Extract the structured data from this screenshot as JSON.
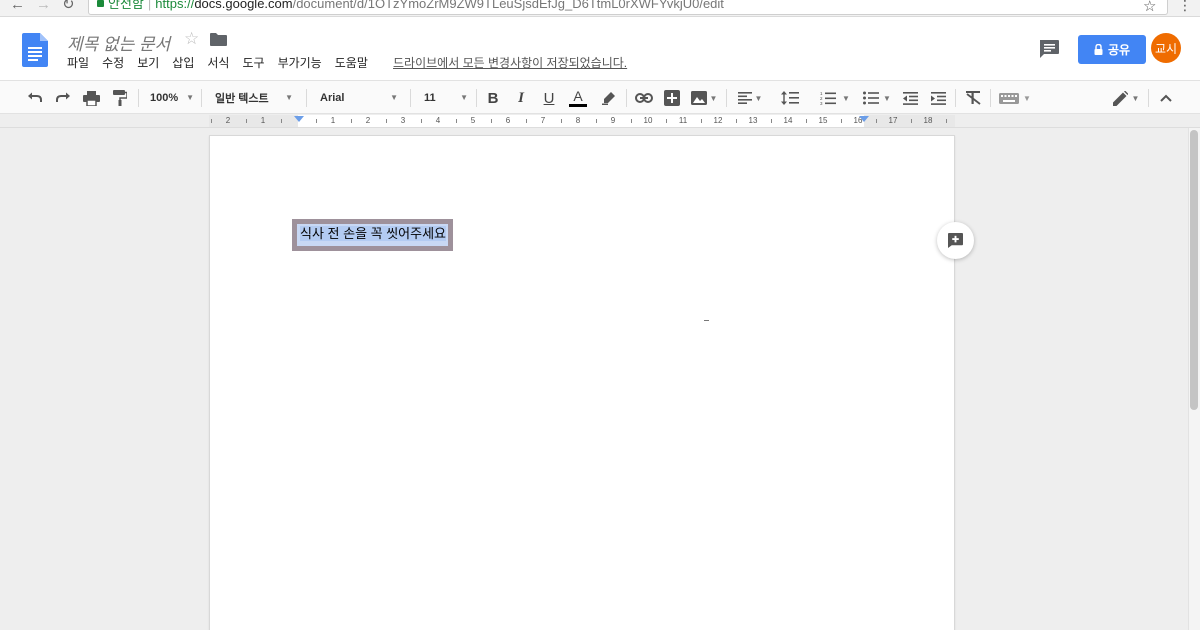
{
  "browser": {
    "back_glyph": "←",
    "forward_glyph": "→",
    "reload_glyph": "↻",
    "secure_label": "안전함",
    "url_scheme": "https://",
    "url_host": "docs.google.com",
    "url_path": "/document/d/1OTzYmoZrM9ZW9TLeuSjsdEfJg_D6TtmL0rXWFYvkjU0/edit",
    "star_glyph": "☆",
    "menu_glyph": "⋮"
  },
  "header": {
    "doc_title": "제목 없는 문서",
    "star_glyph": "☆",
    "menu": [
      "파일",
      "수정",
      "보기",
      "삽입",
      "서식",
      "도구",
      "부가기능",
      "도움말"
    ],
    "save_status": "드라이브에서 모든 변경사항이 저장되었습니다.",
    "share_label": "공유",
    "avatar_initials": "교시"
  },
  "toolbar": {
    "zoom": "100%",
    "style": "일반 텍스트",
    "font": "Arial",
    "font_size": "11",
    "bold": "B",
    "italic": "I",
    "underline": "U",
    "text_color_letter": "A"
  },
  "ruler": {
    "labels": [
      "2",
      "1",
      "1",
      "2",
      "3",
      "4",
      "5",
      "6",
      "7",
      "8",
      "9",
      "10",
      "11",
      "12",
      "13",
      "14",
      "15",
      "16",
      "17",
      "18"
    ]
  },
  "document": {
    "selected_text": "식사 전 손을 꼭 씻어주세요"
  },
  "colors": {
    "accent": "#4285f4",
    "avatar": "#ef6c00",
    "secure": "#1b8a3a",
    "selection": "#c8d8f4",
    "selection_border": "#9e919b"
  },
  "icons": {
    "undo": "undo-icon",
    "redo": "redo-icon",
    "print": "print-icon",
    "paint_format": "paint-format-icon",
    "highlight": "highlight-pen-icon",
    "link": "link-icon",
    "comment": "add-comment-icon",
    "image": "image-icon",
    "align": "align-left-icon",
    "line_spacing": "line-spacing-icon",
    "numbered_list": "numbered-list-icon",
    "bulleted_list": "bulleted-list-icon",
    "decrease_indent": "decrease-indent-icon",
    "increase_indent": "increase-indent-icon",
    "clear_format": "clear-format-icon",
    "keyboard": "keyboard-icon",
    "editing_mode": "pencil-icon",
    "collapse": "chevron-up-icon"
  }
}
